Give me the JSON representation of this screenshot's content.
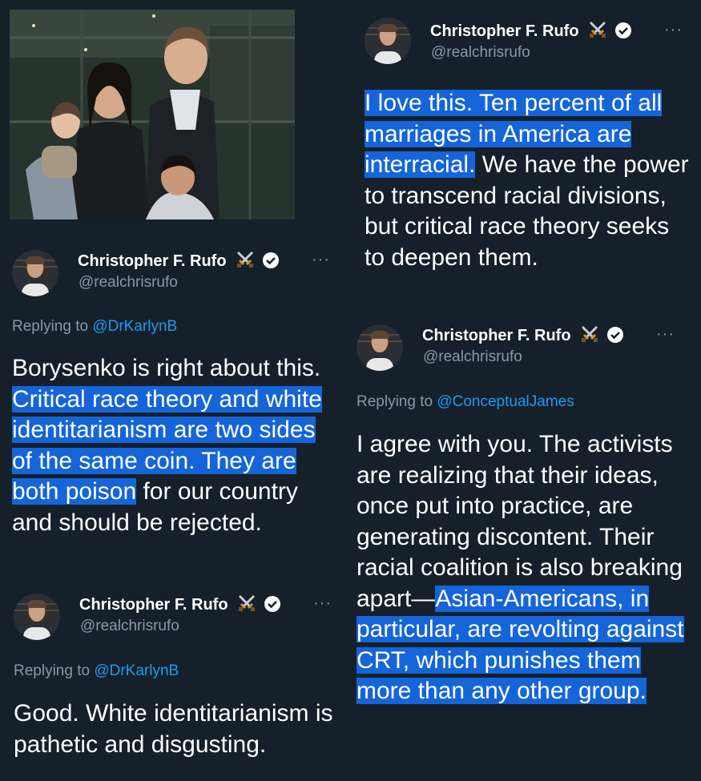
{
  "tweets": [
    {
      "name": "Christopher F. Rufo",
      "handle": "@realchrisrufo",
      "more": "···",
      "body_plain": "",
      "body_hl": "I love this. Ten percent of all marriages in America are interracial.",
      "body_rest": " We have the power to transcend racial divisions, but critical race theory seeks to deepen them."
    },
    {
      "name": "Christopher F. Rufo",
      "handle": "@realchrisrufo",
      "more": "···",
      "reply_prefix": "Replying to ",
      "reply_to": "@DrKarlynB",
      "body_plain": "Borysenko is right about this. ",
      "body_hl": "Critical race theory and white identitarianism are two sides of the same coin. They are both poison",
      "body_rest": " for our country and should be rejected."
    },
    {
      "name": "Christopher F. Rufo",
      "handle": "@realchrisrufo",
      "more": "···",
      "reply_prefix": "Replying to ",
      "reply_to": "@DrKarlynB",
      "body_plain": "Good. White identitarianism is pathetic and disgusting."
    },
    {
      "name": "Christopher F. Rufo",
      "handle": "@realchrisrufo",
      "more": "···",
      "reply_prefix": "Replying to ",
      "reply_to": "@ConceptualJames",
      "body_plain": "I agree with you. The activists are realizing that their ideas, once put into practice, are generating discontent. Their racial coalition is also breaking apart—",
      "body_hl": "Asian-Americans, in particular, are revolting against CRT, which punishes them more than any other group."
    }
  ],
  "colors": {
    "background": "#15202b",
    "highlight": "#1565d8",
    "link": "#1d9bf0",
    "secondary_text": "#8b98a5"
  },
  "icons": [
    "verified-badge-icon",
    "crossed-swords-icon",
    "more-options-icon"
  ]
}
